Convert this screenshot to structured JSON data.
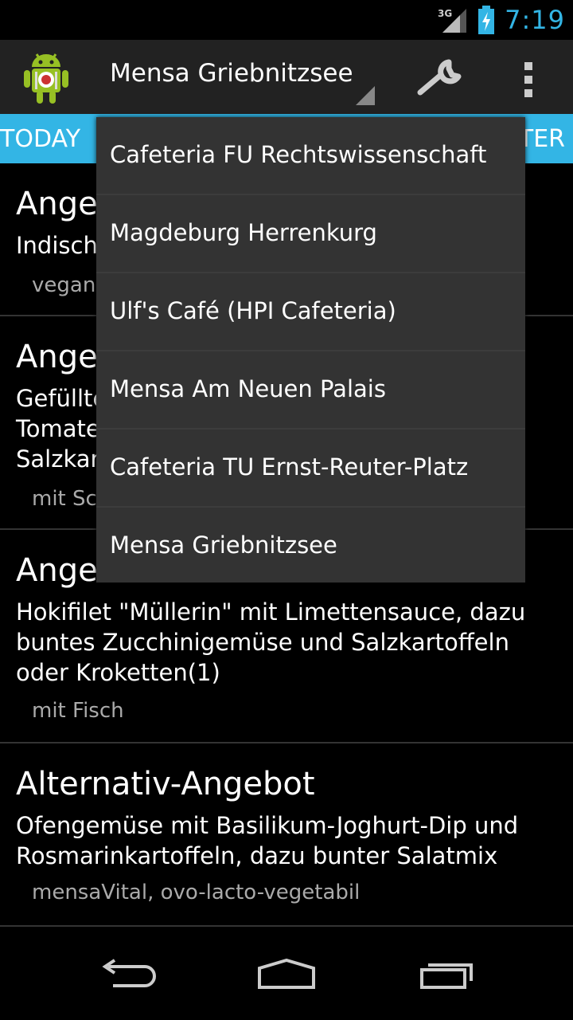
{
  "status_bar": {
    "network": "3G",
    "time": "7:19",
    "battery_color": "#33b5e5"
  },
  "action_bar": {
    "selected_location": "Mensa Griebnitzsee",
    "icons": [
      "android-app-icon",
      "wrench-icon",
      "overflow-menu-icon"
    ]
  },
  "tabs": {
    "left": "TODAY",
    "right_partial": "TER"
  },
  "menu": [
    {
      "title": "Ange",
      "description": "Indisch",
      "tags": "vegan"
    },
    {
      "title": "Ange",
      "description": "Gefüllte\nTomate\nSalzkar",
      "tags": "mit Sc"
    },
    {
      "title": "Ange",
      "description": "Hokifilet \"Müllerin\" mit Limettensauce, dazu buntes Zucchinigemüse und Salzkartoffeln oder Kroketten(1)",
      "tags": "mit Fisch"
    },
    {
      "title": "Alternativ-Angebot",
      "description": "Ofengemüse mit Basilikum-Joghurt-Dip und Rosmarinkartoffeln, dazu bunter Salatmix",
      "tags": "mensaVital, ovo-lacto-vegetabil"
    }
  ],
  "dropdown": {
    "options": [
      "Cafeteria FU Rechtswissenschaft",
      "Magdeburg Herrenkurg",
      "Ulf's Café (HPI Cafeteria)",
      "Mensa Am Neuen Palais",
      "Cafeteria TU Ernst-Reuter-Platz",
      "Mensa Griebnitzsee"
    ]
  },
  "nav_bar": {
    "buttons": [
      "back-icon",
      "home-icon",
      "recents-icon"
    ]
  }
}
